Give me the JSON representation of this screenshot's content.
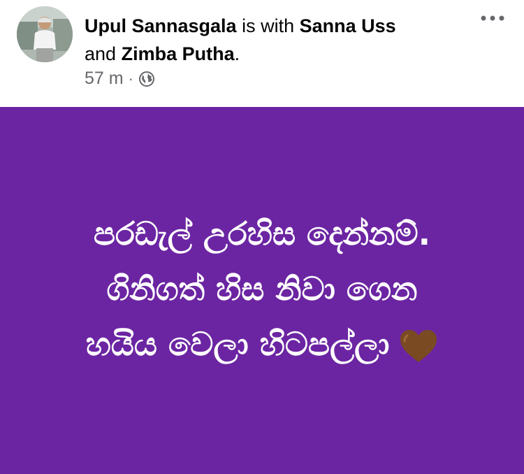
{
  "post": {
    "author": "Upul Sannasgala",
    "with_text": "is with",
    "tagged_1": "Sanna Uss",
    "and_text": "and",
    "tagged_2": "Zimba Putha",
    "period": ".",
    "time": "57 m",
    "separator": "·",
    "privacy_icon": "globe-icon",
    "more_icon": "more-options-icon"
  },
  "content": {
    "background_color": "#6b25a2",
    "text_color": "#ffffff",
    "lines": [
      "පරඩැල් උරහිස දෙන්නම්.",
      "ගිනිගත් හිස නිවා ගෙන",
      "හයිය වෙලා හිටපල්ලා"
    ],
    "emoji": "brown-heart",
    "emoji_color": "#7a4a22"
  }
}
